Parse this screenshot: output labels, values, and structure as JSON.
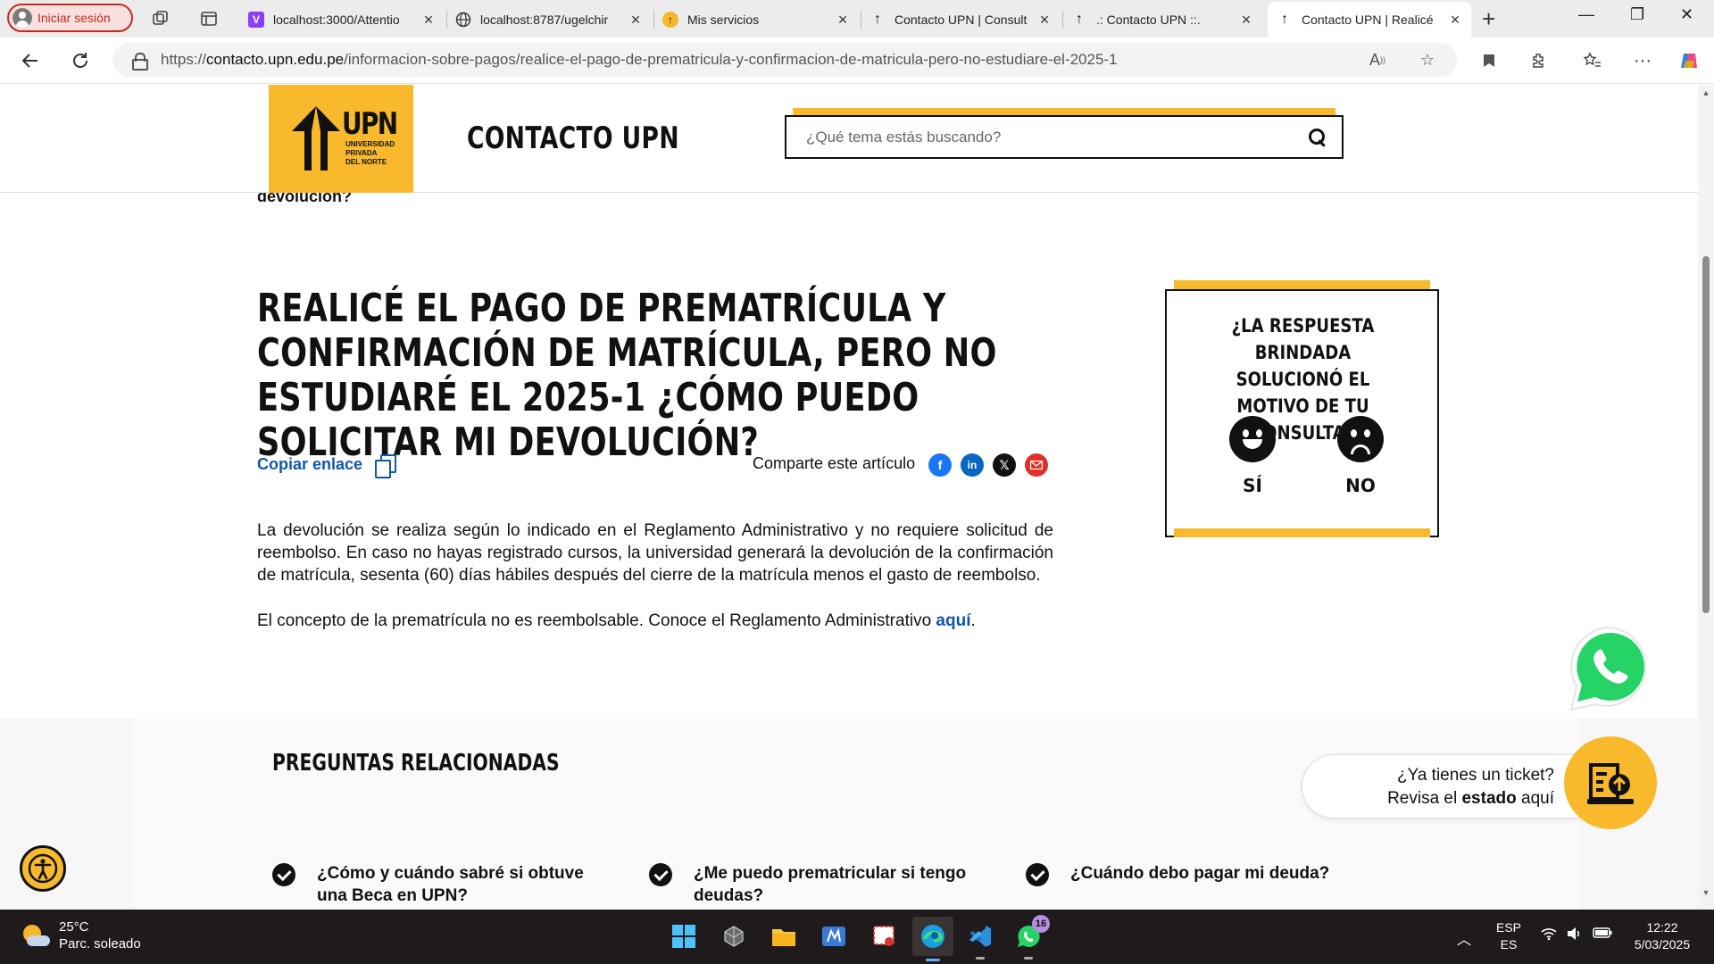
{
  "browser": {
    "profile_label": "Iniciar sesión",
    "tabs": [
      {
        "title": "localhost:3000/Attentio",
        "favicon": "V"
      },
      {
        "title": "localhost:8787/ugelchir",
        "favicon": "globe"
      },
      {
        "title": "Mis servicios",
        "favicon": "upn-yellow"
      },
      {
        "title": "Contacto UPN | Consult",
        "favicon": "upn"
      },
      {
        "title": ".: Contacto UPN ::.",
        "favicon": "upn"
      },
      {
        "title": "Contacto UPN | Realicé",
        "favicon": "upn"
      }
    ],
    "url_prefix": "https://",
    "url_domain": "contacto.upn.edu.pe",
    "url_path": "/informacion-sobre-pagos/realice-el-pago-de-prematricula-y-confirmacion-de-matricula-pero-no-estudiare-el-2025-1"
  },
  "header": {
    "logo_text": "UPN",
    "logo_sub": [
      "UNIVERSIDAD",
      "PRIVADA",
      "DEL NORTE"
    ],
    "site_title": "CONTACTO UPN",
    "search_placeholder": "¿Qué tema estás buscando?"
  },
  "prev_fragment": "devolución?",
  "article": {
    "title": "REALICÉ EL PAGO DE PREMATRÍCULA Y CONFIRMACIÓN DE MATRÍCULA, PERO NO ESTUDIARÉ EL 2025-1 ¿CÓMO PUEDO SOLICITAR MI DEVOLUCIÓN?",
    "copy_link": "Copiar enlace",
    "share_label": "Comparte este artículo",
    "paragraph1": "La devolución se realiza según lo indicado en el Reglamento Administrativo y no requiere solicitud de reembolso. En caso no hayas registrado cursos, la universidad generará la devolución de la confirmación de matrícula, sesenta (60) días hábiles después del cierre de la matrícula menos el gasto de reembolso.",
    "paragraph2_text": "El concepto de la prematrícula no es reembolsable. Conoce el Reglamento Administrativo ",
    "paragraph2_link": "aquí",
    "paragraph2_end": "."
  },
  "feedback": {
    "question": "¿LA RESPUESTA BRINDADA SOLUCIONÓ EL MOTIVO DE TU CONSULTA?",
    "yes_label": "SÍ",
    "no_label": "NO"
  },
  "related": {
    "title": "PREGUNTAS RELACIONADAS",
    "items": [
      "¿Cómo y cuándo sabré si obtuve una Beca en UPN?",
      "¿Me puedo prematricular si tengo deudas?",
      "¿Cuándo debo pagar mi deuda?"
    ]
  },
  "ticket": {
    "line1": "¿Ya tienes un ticket?",
    "line2_pre": "Revisa el ",
    "line2_bold": "estado",
    "line2_post": " aquí"
  },
  "taskbar": {
    "temp": "25°C",
    "weather": "Parc. soleado",
    "whatsapp_badge": "16",
    "lang1": "ESP",
    "lang2": "ES",
    "time": "12:22",
    "date": "5/03/2025"
  },
  "colors": {
    "brand_yellow": "#f9b92d",
    "link_blue": "#1057a8",
    "facebook": "#1877f2",
    "linkedin": "#0a66c2",
    "x": "#111111",
    "email": "#e0302a",
    "whatsapp": "#25d366"
  }
}
